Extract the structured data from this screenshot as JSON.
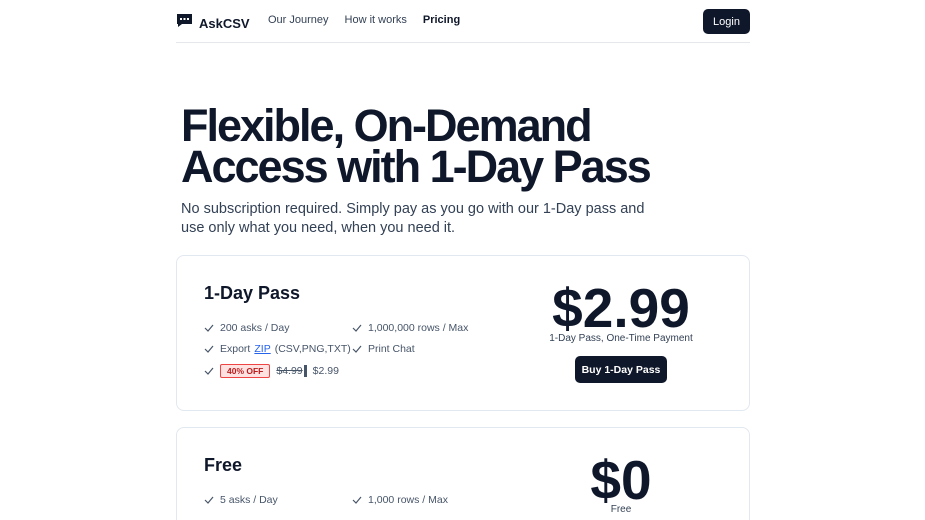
{
  "nav": {
    "brand": "AskCSV",
    "links": [
      {
        "label": "Our Journey"
      },
      {
        "label": "How it works"
      },
      {
        "label": "Pricing"
      }
    ],
    "login_label": "Login"
  },
  "hero": {
    "title": "Flexible, On-Demand Access with 1-Day Pass",
    "subtitle": "No subscription required. Simply pay as you go with our 1-Day pass and use only what you need, when you need it."
  },
  "plans": [
    {
      "name": "1-Day Pass",
      "features": {
        "asks": "200 asks / Day",
        "rows": "1,000,000 rows / Max",
        "export_prefix": "Export",
        "export_link": "ZIP",
        "export_suffix": "(CSV,PNG,TXT)",
        "print": "Print Chat",
        "discount_badge": "40% OFF",
        "old_price": "$4.99",
        "new_price": "$2.99"
      },
      "price": "$2.99",
      "price_caption": "1-Day Pass, One-Time Payment",
      "cta": "Buy 1-Day Pass"
    },
    {
      "name": "Free",
      "features": {
        "asks": "5 asks / Day",
        "rows": "1,000 rows / Max"
      },
      "price": "$0",
      "price_caption": "Free"
    }
  ],
  "colors": {
    "primary": "#0f172a",
    "link": "#2563eb",
    "badge_border": "#ef4444",
    "badge_bg": "#fee2e2"
  },
  "icons": [
    "chat-logo-icon",
    "check-icon"
  ]
}
